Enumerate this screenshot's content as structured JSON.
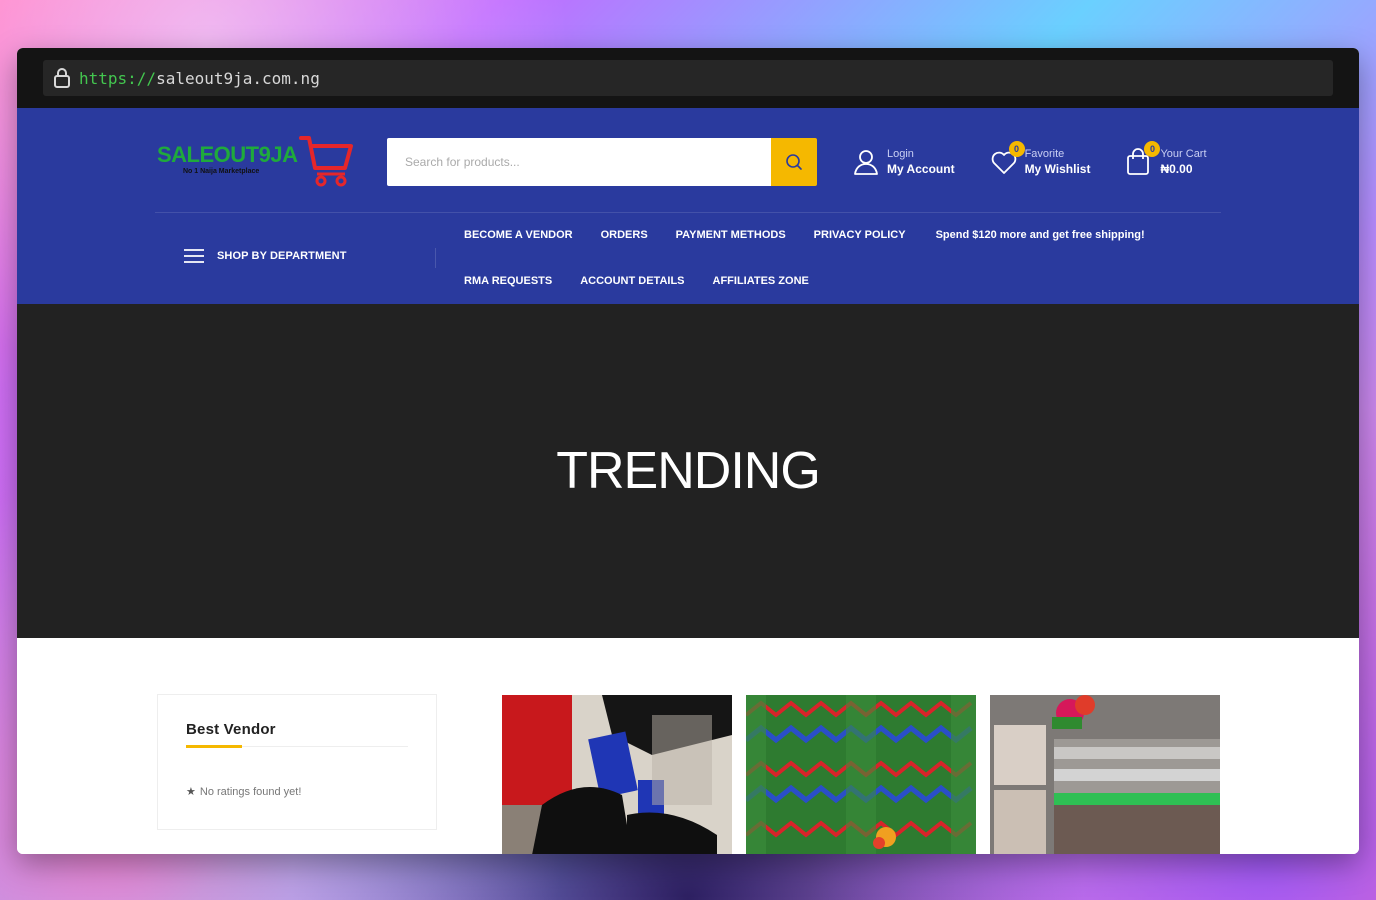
{
  "browser": {
    "url_scheme": "https://",
    "url_host": "saleout9ja.com.ng"
  },
  "logo": {
    "wordmark": "SALEOUT9JA",
    "tagline": "No 1 Naija Marketplace"
  },
  "search": {
    "placeholder": "Search for products..."
  },
  "actions": {
    "account": {
      "small": "Login",
      "big": "My Account"
    },
    "wishlist": {
      "small": "Favorite",
      "big": "My Wishlist",
      "count": "0"
    },
    "cart": {
      "small": "Your Cart",
      "big": "₦0.00",
      "count": "0"
    }
  },
  "department": {
    "label": "SHOP BY DEPARTMENT"
  },
  "nav": {
    "row1": [
      "BECOME A VENDOR",
      "ORDERS",
      "PAYMENT METHODS",
      "PRIVACY POLICY"
    ],
    "promo": "Spend $120 more and get free shipping!",
    "row2": [
      "RMA REQUESTS",
      "ACCOUNT DETAILS",
      "AFFILIATES ZONE"
    ]
  },
  "hero": {
    "title": "TRENDING"
  },
  "vendor": {
    "title": "Best Vendor",
    "empty": "No ratings found yet!"
  },
  "colors": {
    "header_bg": "#2a3a9e",
    "accent": "#f5b800",
    "hero_bg": "#222222",
    "logo_green": "#1faa3c",
    "logo_red": "#e5262a"
  }
}
